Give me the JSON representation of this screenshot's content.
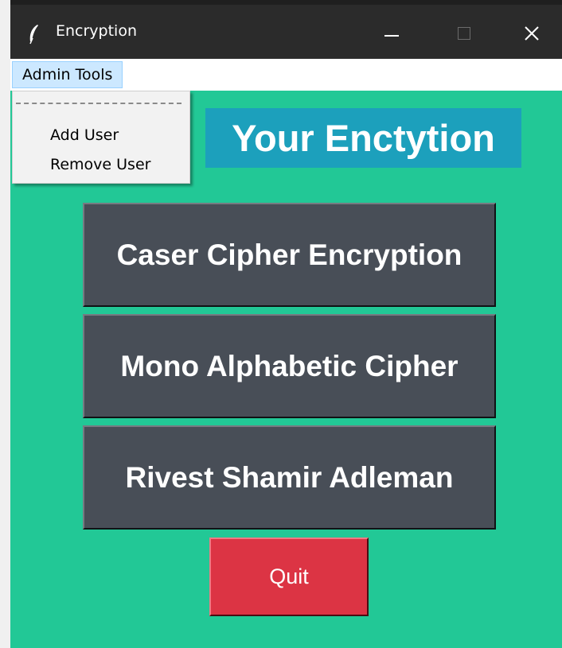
{
  "window": {
    "title": "Encryption",
    "icon": "feather-icon",
    "background_color": "#22c896"
  },
  "menubar": {
    "items": [
      {
        "label": "Admin Tools"
      }
    ]
  },
  "dropdown": {
    "items": [
      {
        "label": "Add User"
      },
      {
        "label": "Remove User"
      }
    ]
  },
  "main": {
    "heading": "Your Enctytion",
    "heading_color": "#1ca0bc",
    "buttons": [
      {
        "label": "Caser Cipher Encryption"
      },
      {
        "label": "Mono Alphabetic Cipher"
      },
      {
        "label": "Rivest Shamir Adleman"
      }
    ],
    "button_color": "#484e57",
    "quit_label": "Quit",
    "quit_color": "#dc3444"
  }
}
